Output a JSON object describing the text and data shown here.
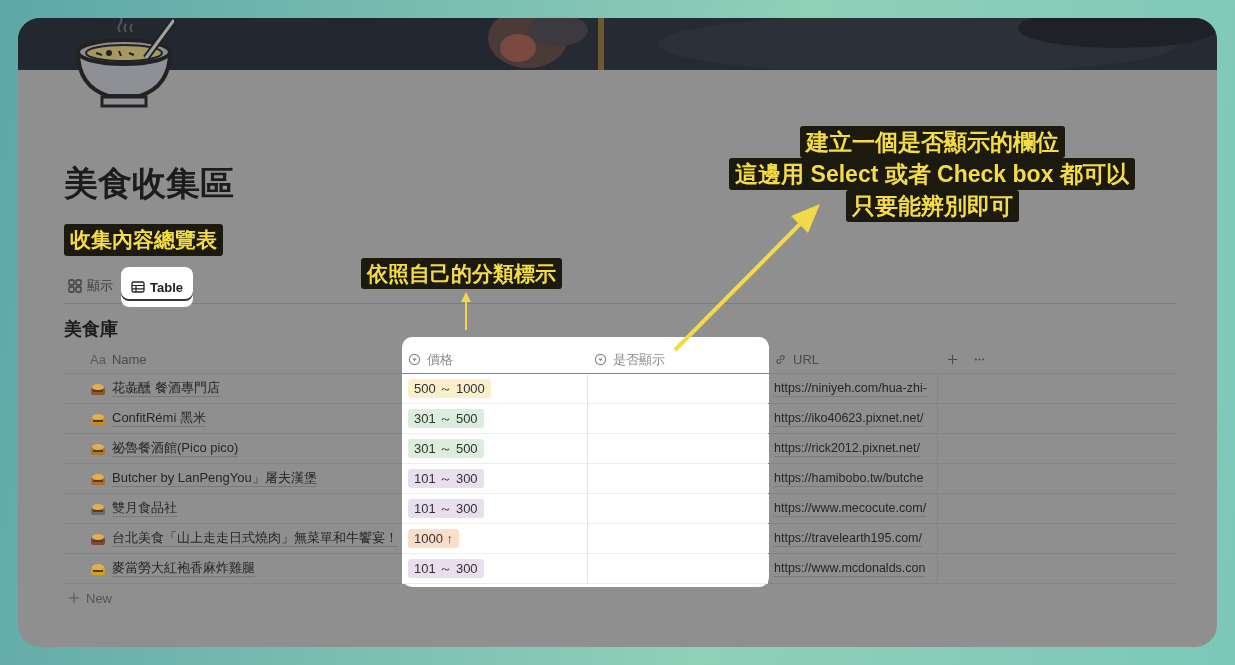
{
  "page": {
    "title": "美食收集區"
  },
  "annotations": [
    {
      "kind": "inline",
      "lines": [
        "收集內容總覽表"
      ]
    },
    {
      "kind": "arrow-up",
      "lines": [
        "依照自己的分類標示"
      ]
    },
    {
      "kind": "arrow-diagonal",
      "lines": [
        "建立一個是否顯示的欄位",
        "這邊用 Select 或者 Check box 都可以",
        "只要能辨別即可"
      ]
    }
  ],
  "views": [
    {
      "label": "顯示",
      "kind": "gallery",
      "selected": false
    },
    {
      "label": "Table",
      "kind": "table",
      "selected": true
    }
  ],
  "database": {
    "title": "美食庫",
    "columns": [
      {
        "label": "Name",
        "kind": "title",
        "prefix": "Aa"
      },
      {
        "label": "價格",
        "kind": "select"
      },
      {
        "label": "是否顯示",
        "kind": "select"
      },
      {
        "label": "URL",
        "kind": "url"
      }
    ],
    "rows": [
      {
        "name": "花彘醺 餐酒專門店",
        "price": {
          "label": "500 ～ 1000",
          "color": "#fbeecc"
        },
        "url": "https://niniyeh.com/hua-zhi-"
      },
      {
        "name": "ConfitRémi 黑米",
        "price": {
          "label": "301 ～ 500",
          "color": "#dbeddb"
        },
        "url": "https://iko40623.pixnet.net/"
      },
      {
        "name": "祕魯餐酒館(Pico pico)",
        "price": {
          "label": "301 ～ 500",
          "color": "#dbeddb"
        },
        "url": "https://rick2012.pixnet.net/"
      },
      {
        "name": "Butcher by LanPengYou」屠夫漢堡",
        "price": {
          "label": "101 ～ 300",
          "color": "#e8deee"
        },
        "url": "https://hamibobo.tw/butche"
      },
      {
        "name": "雙月食品社",
        "price": {
          "label": "101 ～ 300",
          "color": "#e8deee"
        },
        "url": "https://www.mecocute.com/"
      },
      {
        "name": "台北美食「山上走走日式燒肉」無菜單和牛饗宴！",
        "price": {
          "label": "1000 ↑",
          "color": "#fadec9"
        },
        "url": "https://travelearth195.com/"
      },
      {
        "name": "麥當勞大紅袍香麻炸雞腿",
        "price": {
          "label": "101 ～ 300",
          "color": "#e8deee"
        },
        "url": "https://www.mcdonalds.con"
      }
    ],
    "new_row": "New"
  }
}
